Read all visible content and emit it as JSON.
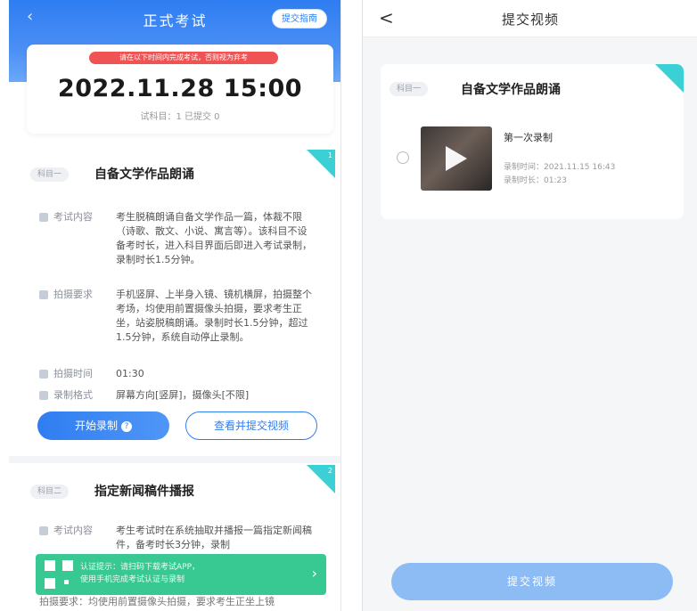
{
  "left": {
    "header": {
      "title": "正式考试",
      "action_label": "提交指南",
      "back_icon": "back-icon"
    },
    "alert_text": "请在以下时间内完成考试，否则视为弃考",
    "exam_datetime": "2022.11.28 15:00",
    "meta_text": "试科目：1 已提交 0",
    "items": [
      {
        "badge": "科目一",
        "title": "自备文学作品朗诵",
        "corner": "1",
        "rows": [
          {
            "label": "考试内容",
            "value": "考生脱稿朗诵自备文学作品一篇，体裁不限（诗歌、散文、小说、寓言等）。该科目不设备考时长，进入科目界面后即进入考试录制，录制时长1.5分钟。"
          },
          {
            "label": "拍摄要求",
            "value": "手机竖屏、上半身入镜、镜机横屏，拍摄整个考场，均使用前置摄像头拍摄，要求考生正坐，站姿脱稿朗诵。录制时长1.5分钟，超过1.5分钟，系统自动停止录制。"
          },
          {
            "label": "拍摄时间",
            "value": "01:30"
          },
          {
            "label": "录制格式",
            "value": "屏幕方向[竖屏]，摄像头[不限]"
          }
        ],
        "start_label": "开始录制",
        "view_label": "查看并提交视频"
      },
      {
        "badge": "科目二",
        "title": "指定新闻稿件播报",
        "corner": "2",
        "rows": [
          {
            "label": "考试内容",
            "value": "考生考试时在系统抽取并播报一篇指定新闻稿件，备考时长3分钟，录制"
          }
        ],
        "extra_text": "拍摄要求：均使用前置摄像头拍摄，要求考生正坐上镜"
      }
    ],
    "qr_banner": {
      "line1": "认证提示：请扫码下载考试APP，",
      "line2": "使用手机完成考试认证与录制",
      "arrow": "›"
    }
  },
  "right": {
    "header": {
      "title": "提交视频",
      "back_glyph": "<"
    },
    "card": {
      "badge": "科目一",
      "title": "自备文学作品朗诵",
      "recording": {
        "title": "第一次录制",
        "time": "录制时间：2021.11.15 16:43",
        "duration": "录制时长：01:23"
      }
    },
    "submit_label": "提交视频"
  },
  "colors": {
    "accent": "#2f7df2",
    "corner": "#3bd0d6",
    "alert": "#f05353",
    "qr": "#28c58a",
    "submit_disabled": "#8dbcf5"
  }
}
